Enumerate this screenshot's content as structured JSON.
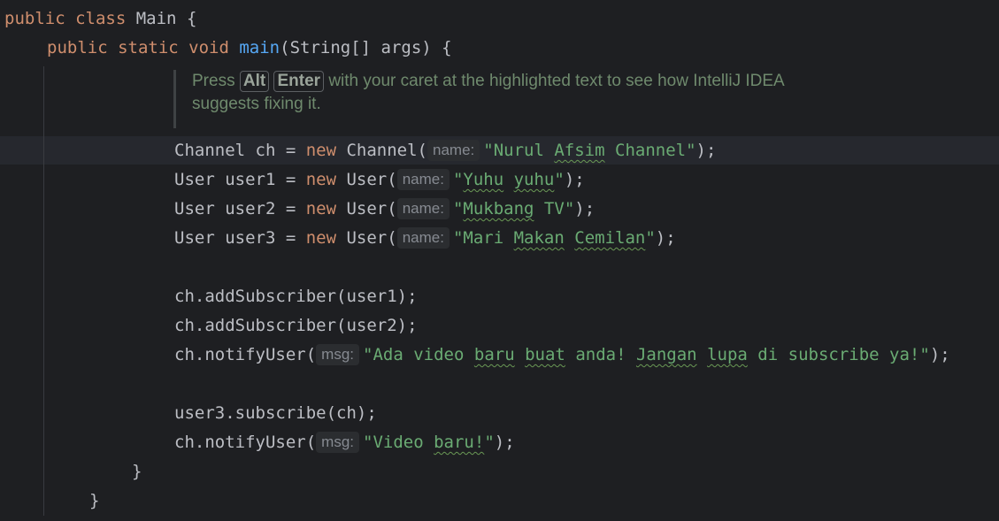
{
  "editor": {
    "class_decl": {
      "kw": "public class",
      "name": "Main",
      "brace": " {"
    },
    "method_decl": {
      "kw": "public static void",
      "name": "main",
      "params": "(String[] args) {"
    },
    "tip": {
      "press": "Press",
      "key1": "Alt",
      "key2": "Enter",
      "rest_line1": "with your caret at the highlighted text to see how IntelliJ IDEA",
      "line2": "suggests fixing it."
    },
    "decls": [
      {
        "type": "Channel",
        "var": "ch",
        "cls": "Channel",
        "hint": "name:",
        "arg_words": [
          "Nurul",
          "Afsim",
          "Channel"
        ]
      },
      {
        "type": "User",
        "var": "user1",
        "cls": "User",
        "hint": "name:",
        "arg_words": [
          "Yuhu",
          "yuhu"
        ]
      },
      {
        "type": "User",
        "var": "user2",
        "cls": "User",
        "hint": "name:",
        "arg_words": [
          "Mukbang",
          "TV"
        ]
      },
      {
        "type": "User",
        "var": "user3",
        "cls": "User",
        "hint": "name:",
        "arg_words": [
          "Mari",
          "Makan",
          "Cemilan"
        ]
      }
    ],
    "add_lines": [
      "ch.addSubscriber(user1);",
      "ch.addSubscriber(user2);"
    ],
    "notify1": {
      "call": "ch.notifyUser(",
      "hint": "msg:",
      "arg_words": [
        "Ada",
        "video",
        "baru",
        "buat",
        "anda!",
        "Jangan",
        "lupa",
        "di",
        "subscribe",
        "ya!"
      ],
      "end": ");"
    },
    "subscribe_line": "user3.subscribe(ch);",
    "notify2": {
      "call": "ch.notifyUser(",
      "hint": "msg:",
      "arg_words": [
        "Video",
        "baru!"
      ],
      "end": ");"
    },
    "close_method": "}",
    "close_class": "}",
    "keywords": {
      "new": "new",
      "eq": "="
    }
  }
}
